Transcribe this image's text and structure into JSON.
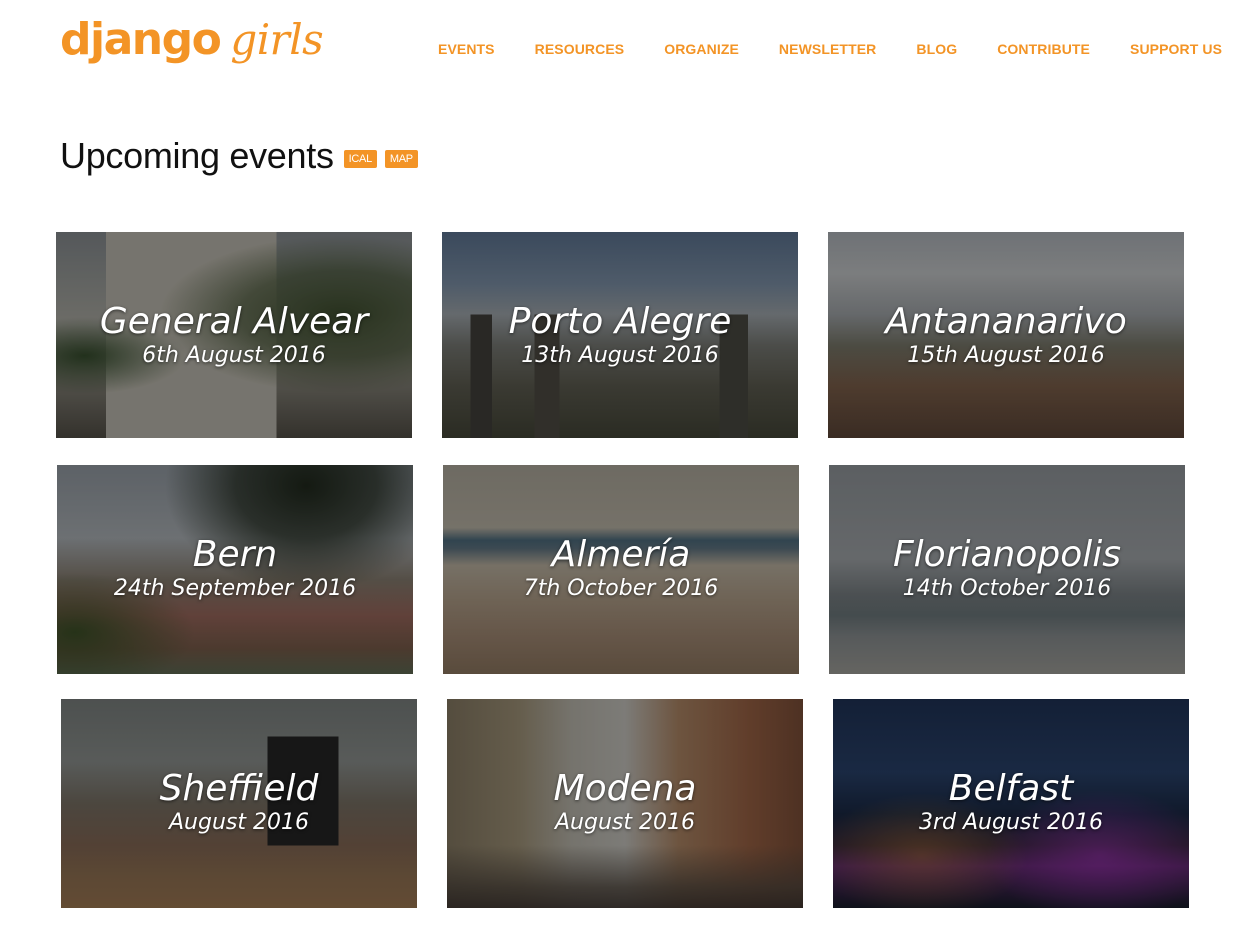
{
  "brand": {
    "logo_word1": "django",
    "logo_word2": "girls",
    "accent": "#f39426"
  },
  "nav": [
    "EVENTS",
    "RESOURCES",
    "ORGANIZE",
    "NEWSLETTER",
    "BLOG",
    "CONTRIBUTE",
    "SUPPORT US"
  ],
  "page": {
    "title": "Upcoming events",
    "ical_label": "ICAL",
    "map_label": "MAP"
  },
  "events": [
    {
      "city": "General Alvear",
      "date": "6th August 2016"
    },
    {
      "city": "Porto Alegre",
      "date": "13th August 2016"
    },
    {
      "city": "Antananarivo",
      "date": "15th August 2016"
    },
    {
      "city": "Bern",
      "date": "24th September 2016"
    },
    {
      "city": "Almería",
      "date": "7th October 2016"
    },
    {
      "city": "Florianopolis",
      "date": "14th October 2016"
    },
    {
      "city": "Sheffield",
      "date": "August 2016"
    },
    {
      "city": "Modena",
      "date": "August 2016"
    },
    {
      "city": "Belfast",
      "date": "3rd August 2016"
    }
  ]
}
